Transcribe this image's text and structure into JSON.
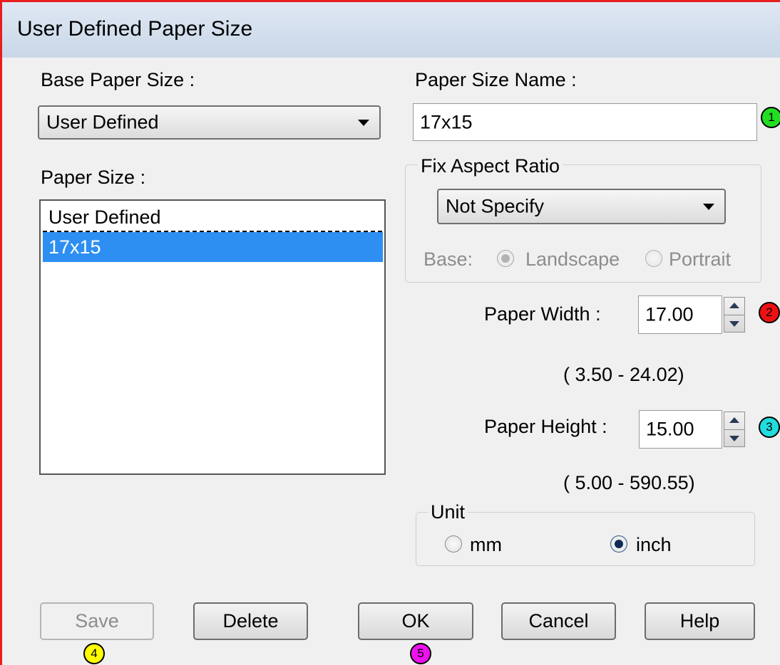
{
  "window": {
    "title": "User Defined Paper Size"
  },
  "base_paper_size": {
    "label": "Base Paper Size :",
    "selected": "User Defined"
  },
  "paper_size": {
    "label": "Paper Size :",
    "items": [
      "User Defined",
      "17x15"
    ],
    "selected_index": 1
  },
  "paper_size_name": {
    "label": "Paper Size Name :",
    "value": "17x15"
  },
  "fix_aspect_ratio": {
    "label": "Fix Aspect Ratio",
    "selected": "Not Specify",
    "base_label": "Base:",
    "landscape_label": "Landscape",
    "portrait_label": "Portrait"
  },
  "paper_width": {
    "label": "Paper Width  :",
    "value": "17.00",
    "range": "( 3.50 - 24.02)"
  },
  "paper_height": {
    "label": "Paper Height :",
    "value": "15.00",
    "range": "( 5.00 - 590.55)"
  },
  "unit": {
    "label": "Unit",
    "mm_label": "mm",
    "inch_label": "inch",
    "selected": "inch"
  },
  "buttons": {
    "save": "Save",
    "delete": "Delete",
    "ok": "OK",
    "cancel": "Cancel",
    "help": "Help"
  },
  "badges": [
    "1",
    "2",
    "3",
    "4",
    "5"
  ],
  "colors": {
    "frame": "#e81d1d",
    "selection": "#2e8ff2",
    "badge_1": "#22dd22",
    "badge_2": "#ee1111",
    "badge_3": "#22dddd",
    "badge_4": "#ffff00",
    "badge_5": "#ee11ee"
  }
}
